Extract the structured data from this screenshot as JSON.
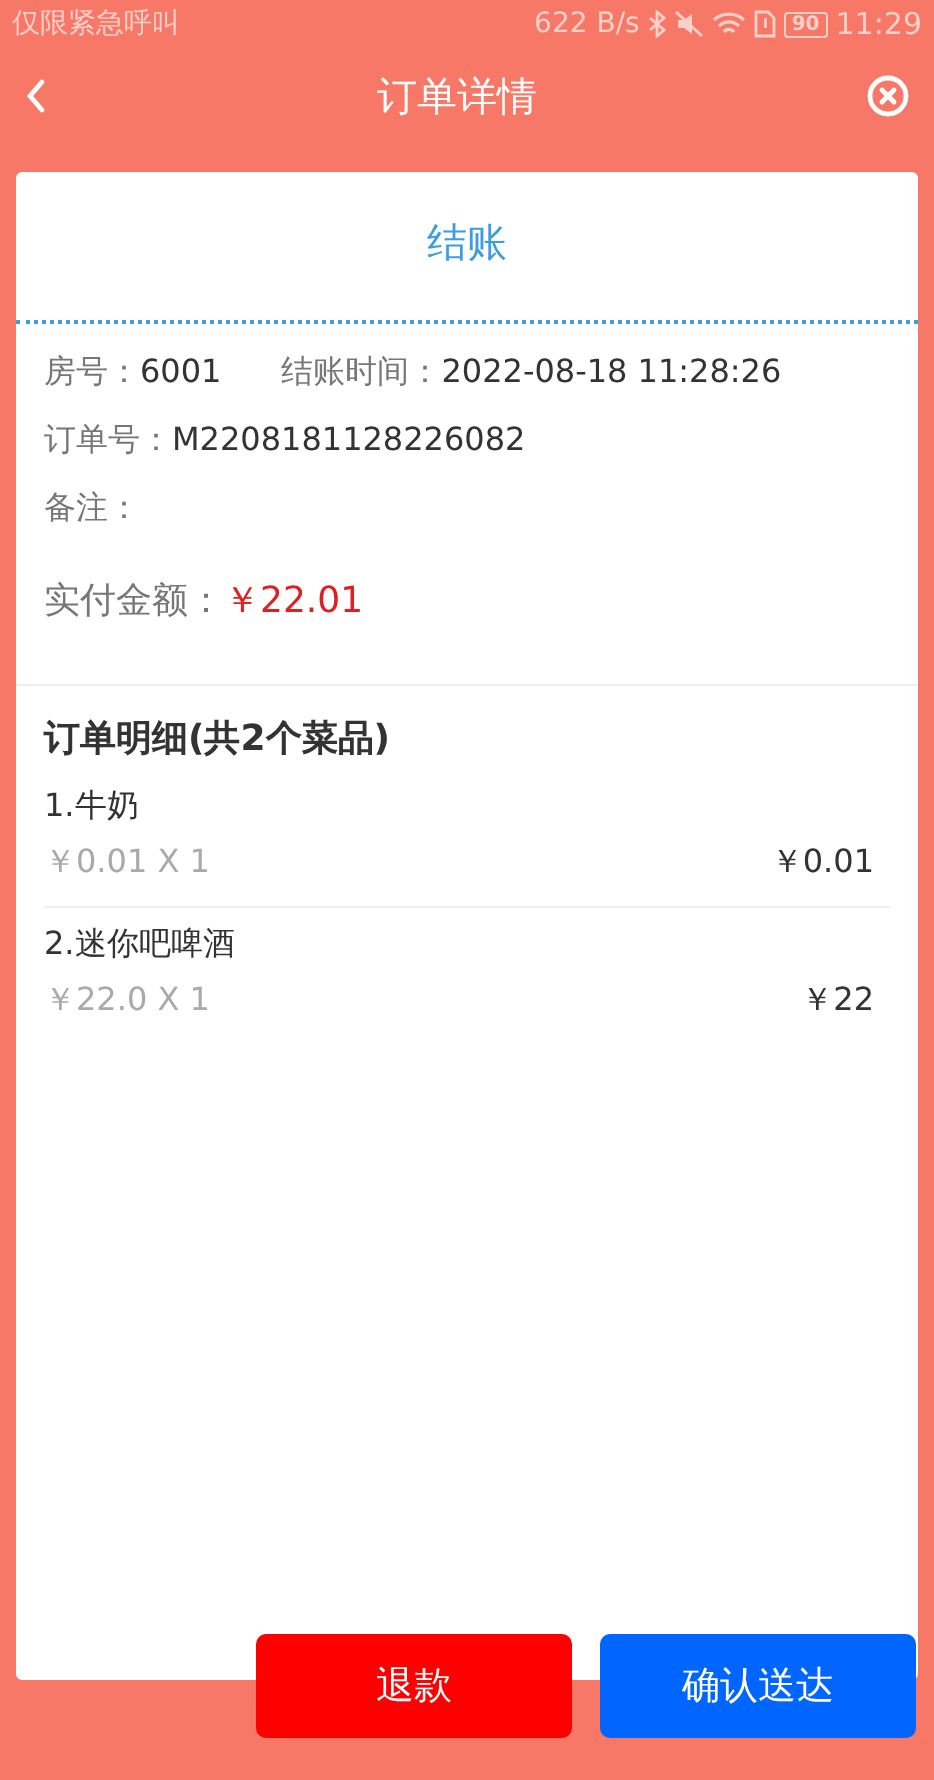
{
  "status_bar": {
    "carrier": "仅限紧急呼叫",
    "speed": "622 B/s",
    "battery": "90",
    "time": "11:29"
  },
  "header": {
    "title": "订单详情"
  },
  "card": {
    "title": "结账",
    "info": {
      "room_label": "房号：",
      "room": "6001",
      "time_label": "结账时间：",
      "time": "2022-08-18 11:28:26",
      "order_label": "订单号：",
      "order_no": "M2208181128226082",
      "note_label": "备注：",
      "paid_label": "实付金额：",
      "paid": "￥22.01"
    },
    "details_title": "订单明细(共2个菜品)",
    "items": [
      {
        "name": "1.牛奶",
        "unit": "￥0.01 X 1",
        "subtotal": "￥0.01"
      },
      {
        "name": "2.迷你吧啤酒",
        "unit": "￥22.0 X 1",
        "subtotal": "￥22"
      }
    ]
  },
  "buttons": [
    {
      "label": "退款",
      "kind": "danger"
    },
    {
      "label": "确认送达",
      "kind": "primary"
    }
  ]
}
